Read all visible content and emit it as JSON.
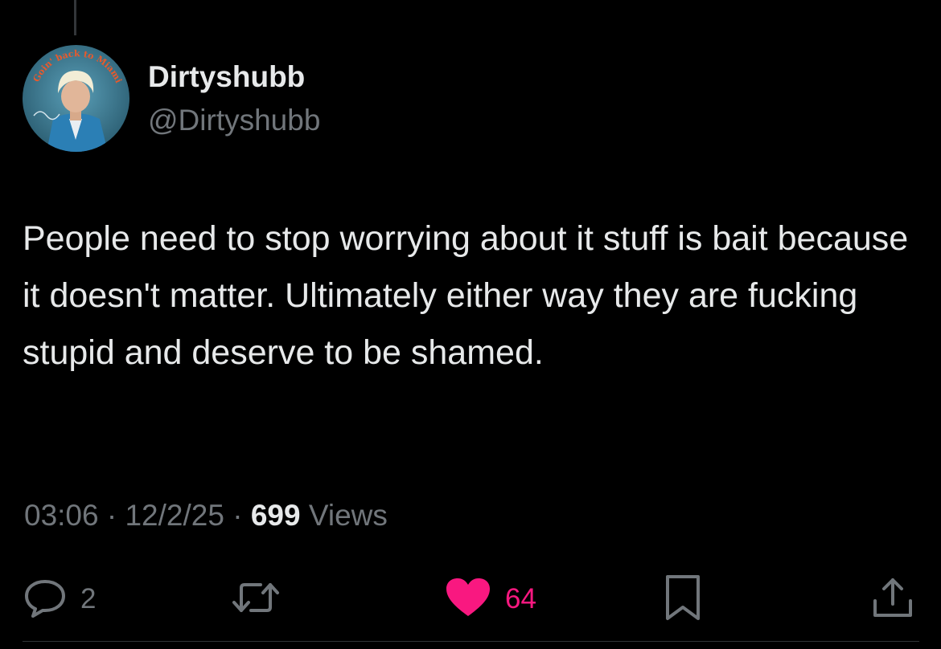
{
  "author": {
    "display_name": "Dirtyshubb",
    "handle": "@Dirtyshubb",
    "avatar_caption": "Goin' back to Miami"
  },
  "tweet": {
    "text": "People need to stop worrying about it stuff is bait because it doesn't matter. Ultimately either way they are fucking stupid and deserve to be shamed."
  },
  "meta": {
    "time": "03:06",
    "separator": "·",
    "date": "12/2/25",
    "views_count": "699",
    "views_label": "Views"
  },
  "actions": {
    "replies": "2",
    "likes": "64",
    "reply_icon": "speech-bubble-icon",
    "retweet_icon": "retweet-arrows-icon",
    "like_icon": "heart-filled-icon",
    "bookmark_icon": "bookmark-icon",
    "share_icon": "share-upload-icon"
  },
  "colors": {
    "background": "#000000",
    "primary_text": "#e7e9ea",
    "secondary_text": "#71767b",
    "like_pink": "#f91880"
  }
}
